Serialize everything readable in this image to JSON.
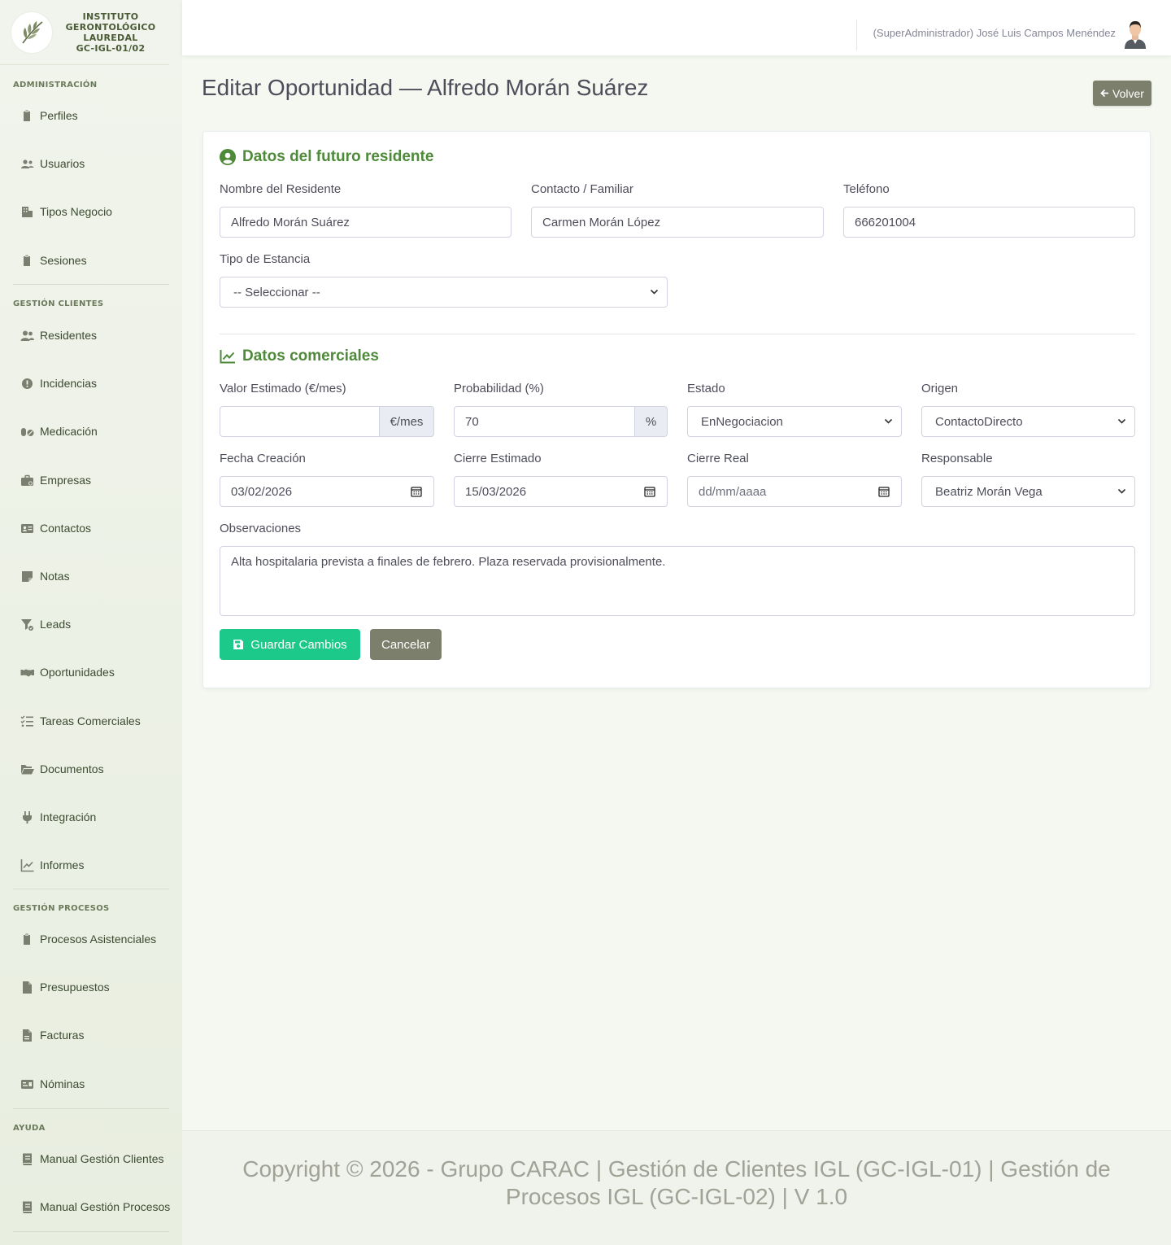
{
  "brand": {
    "line1": "INSTITUTO",
    "line2": "GERONTOLÓGICO",
    "line3": "LAUREDAL",
    "line4": "GC-IGL-01/02"
  },
  "sidebar": {
    "sections": [
      {
        "heading": "ADMINISTRACIÓN",
        "items": [
          {
            "label": "Perfiles",
            "icon": "clipboard-icon"
          },
          {
            "label": "Usuarios",
            "icon": "users-icon"
          },
          {
            "label": "Tipos Negocio",
            "icon": "building-icon"
          },
          {
            "label": "Sesiones",
            "icon": "clipboard-icon"
          }
        ]
      },
      {
        "heading": "GESTIÓN CLIENTES",
        "items": [
          {
            "label": "Residentes",
            "icon": "user-friends-icon"
          },
          {
            "label": "Incidencias",
            "icon": "exclamation-circle-icon"
          },
          {
            "label": "Medicación",
            "icon": "pills-icon"
          },
          {
            "label": "Empresas",
            "icon": "briefcase-icon"
          },
          {
            "label": "Contactos",
            "icon": "address-card-icon"
          },
          {
            "label": "Notas",
            "icon": "sticky-note-icon"
          },
          {
            "label": "Leads",
            "icon": "funnel-icon"
          },
          {
            "label": "Oportunidades",
            "icon": "handshake-icon"
          },
          {
            "label": "Tareas Comerciales",
            "icon": "tasks-icon"
          },
          {
            "label": "Documentos",
            "icon": "folder-open-icon"
          },
          {
            "label": "Integración",
            "icon": "plug-icon"
          },
          {
            "label": "Informes",
            "icon": "chart-line-icon"
          }
        ]
      },
      {
        "heading": "GESTIÓN PROCESOS",
        "items": [
          {
            "label": "Procesos Asistenciales",
            "icon": "clipboard-icon"
          },
          {
            "label": "Presupuestos",
            "icon": "file-icon"
          },
          {
            "label": "Facturas",
            "icon": "file-invoice-icon"
          },
          {
            "label": "Nóminas",
            "icon": "money-check-icon"
          }
        ]
      },
      {
        "heading": "AYUDA",
        "items": [
          {
            "label": "Manual Gestión Clientes",
            "icon": "book-icon"
          },
          {
            "label": "Manual Gestión Procesos",
            "icon": "book-icon"
          }
        ]
      }
    ]
  },
  "topbar": {
    "user": "(SuperAdministrador) José Luis Campos Menéndez"
  },
  "page": {
    "title": "Editar Oportunidad — Alfredo Morán Suárez",
    "back_label": "Volver"
  },
  "resident": {
    "section_title": "Datos del futuro residente",
    "name_label": "Nombre del Residente",
    "name_value": "Alfredo Morán Suárez",
    "contact_label": "Contacto / Familiar",
    "contact_value": "Carmen Morán López",
    "phone_label": "Teléfono",
    "phone_value": "666201004",
    "stay_label": "Tipo de Estancia",
    "stay_value": "-- Seleccionar --"
  },
  "commercial": {
    "section_title": "Datos comerciales",
    "value_label": "Valor Estimado (€/mes)",
    "value_value": "",
    "value_addon": "€/mes",
    "prob_label": "Probabilidad (%)",
    "prob_value": "70",
    "prob_addon": "%",
    "state_label": "Estado",
    "state_value": "EnNegociacion",
    "origin_label": "Origen",
    "origin_value": "ContactoDirecto",
    "created_label": "Fecha Creación",
    "created_value": "03/02/2026",
    "close_est_label": "Cierre Estimado",
    "close_est_value": "15/03/2026",
    "close_real_label": "Cierre Real",
    "close_real_value": "dd/mm/aaaa",
    "owner_label": "Responsable",
    "owner_value": "Beatriz Morán Vega",
    "notes_label": "Observaciones",
    "notes_value": "Alta hospitalaria prevista a finales de febrero. Plaza reservada provisionalmente."
  },
  "actions": {
    "save_label": "Guardar Cambios",
    "cancel_label": "Cancelar"
  },
  "footer": {
    "text": "Copyright © 2026 - Grupo CARAC | Gestión de Clientes IGL (GC-IGL-01) | Gestión de Procesos IGL (GC-IGL-02) | V 1.0"
  },
  "colors": {
    "accent_green": "#4e8a3a",
    "save_button": "#1cc88a",
    "neutral_button": "#7b7f6c",
    "sidebar_bg": "#eef2e8"
  }
}
